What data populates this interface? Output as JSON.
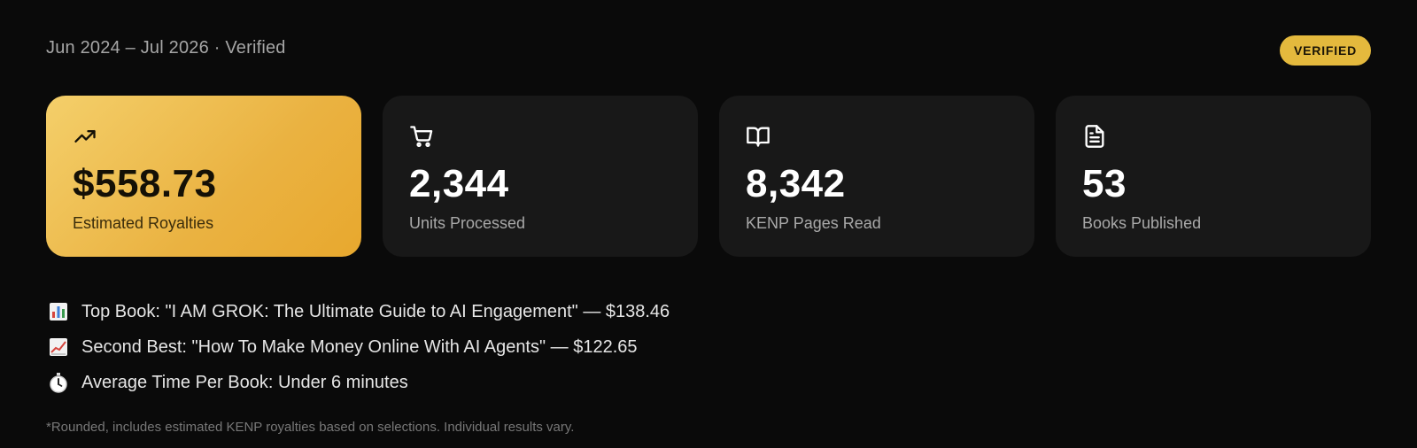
{
  "header": {
    "date_range": "Jun 2024 – Jul 2026 · Verified",
    "badge": "VERIFIED"
  },
  "stats": [
    {
      "icon": "trending-up-icon",
      "value": "$558.73",
      "label": "Estimated Royalties"
    },
    {
      "icon": "shopping-cart-icon",
      "value": "2,344",
      "label": "Units Processed"
    },
    {
      "icon": "open-book-icon",
      "value": "8,342",
      "label": "KENP Pages Read"
    },
    {
      "icon": "document-icon",
      "value": "53",
      "label": "Books Published"
    }
  ],
  "highlights": [
    {
      "icon": "bar-chart-icon",
      "text": "Top Book: \"I AM GROK: The Ultimate Guide to AI Engagement\" — $138.46"
    },
    {
      "icon": "line-chart-icon",
      "text": "Second Best: \"How To Make Money Online With AI Agents\" — $122.65"
    },
    {
      "icon": "stopwatch-icon",
      "text": "Average Time Per Book: Under 6 minutes"
    }
  ],
  "footnote": "*Rounded, includes estimated KENP royalties based on selections. Individual results vary.",
  "colors": {
    "background": "#0a0a0a",
    "card": "#181818",
    "gold": "#e4b93d",
    "muted_text": "#a6a6a6"
  }
}
